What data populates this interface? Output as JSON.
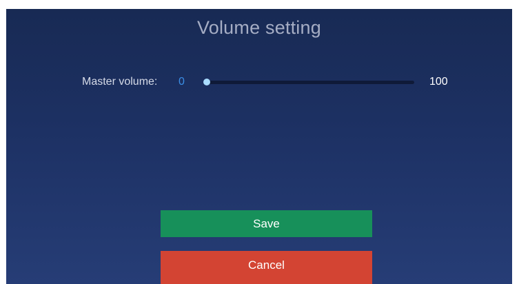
{
  "dialog": {
    "title": "Volume setting"
  },
  "master_volume": {
    "label": "Master volume:",
    "value": "0",
    "max_label": "100",
    "level_percent": 0
  },
  "buttons": {
    "save_label": "Save",
    "cancel_label": "Cancel"
  },
  "colors": {
    "background_top": "#182a54",
    "background_bottom": "#263d76",
    "value_accent": "#3b8fe6",
    "slider_thumb": "#a9dcff",
    "save_button": "#17905a",
    "cancel_button": "#d34433"
  }
}
